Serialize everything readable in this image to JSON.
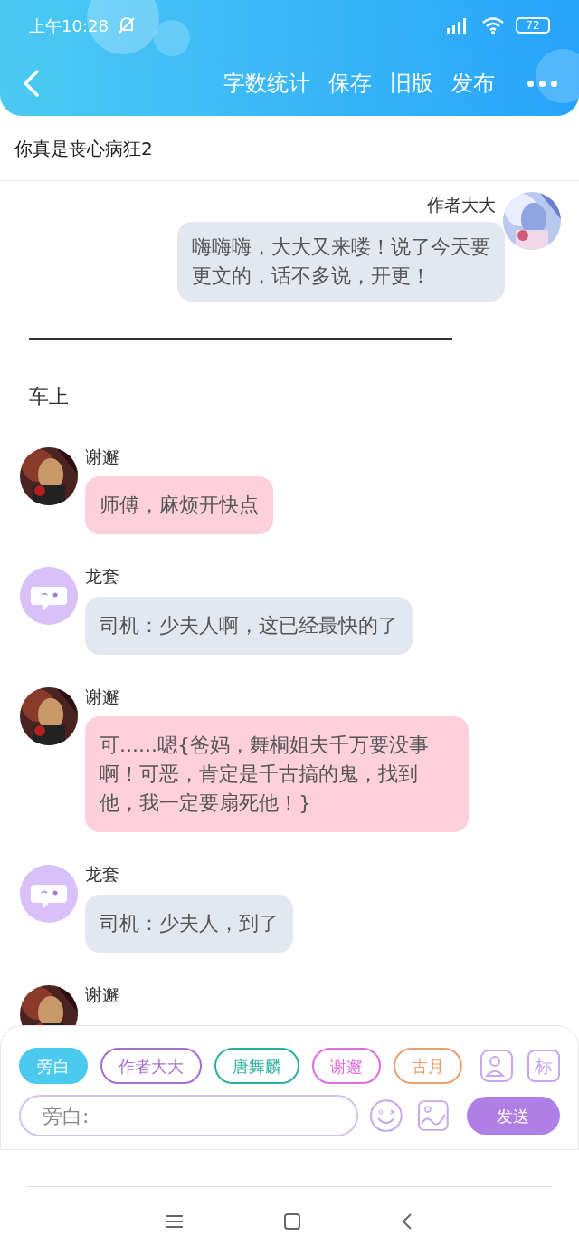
{
  "status_bar": {
    "time": "上午10:28",
    "battery": "72"
  },
  "toolbar": {
    "actions": [
      "字数统计",
      "保存",
      "旧版",
      "发布"
    ]
  },
  "title": "你真是丧心病狂2",
  "chat": [
    {
      "kind": "right",
      "name": "作者大大",
      "color": "#e3e8f0",
      "text": "嗨嗨嗨，大大又来喽！说了今天要更文的，话不多说，开更！"
    },
    {
      "kind": "divider"
    },
    {
      "kind": "narration",
      "text": "车上"
    },
    {
      "kind": "left",
      "name": "谢邂",
      "color": "#fdd0dc",
      "text": "师傅，麻烦开快点"
    },
    {
      "kind": "left",
      "name": "龙套",
      "avatar": {
        "kind": "bot"
      },
      "color": "#e3e8f0",
      "text": "司机：少夫人啊，这已经最快的了"
    },
    {
      "kind": "left",
      "name": "谢邂",
      "color": "#fdd0dc",
      "text": "可......嗯{爸妈，舞桐姐夫千万要没事啊！可恶，肯定是千古搞的鬼，找到他，我一定要扇死他！}"
    },
    {
      "kind": "left",
      "name": "龙套",
      "avatar": {
        "kind": "bot"
      },
      "color": "#e3e8f0",
      "text": "司机：少夫人，到了"
    },
    {
      "kind": "left",
      "name": "谢邂"
    }
  ],
  "roles": [
    {
      "label": "旁白",
      "selected": true,
      "color": "#4cc9ee"
    },
    {
      "label": "作者大大",
      "selected": false,
      "color": "#a46fd0"
    },
    {
      "label": "唐舞麟",
      "selected": false,
      "color": "#2bb09a"
    },
    {
      "label": "谢邂",
      "selected": false,
      "color": "#e06ee0"
    },
    {
      "label": "古月",
      "selected": false,
      "color": "#e8a070"
    }
  ],
  "tag_button": "标",
  "input": {
    "placeholder": "旁白:"
  },
  "send_button": "发送"
}
